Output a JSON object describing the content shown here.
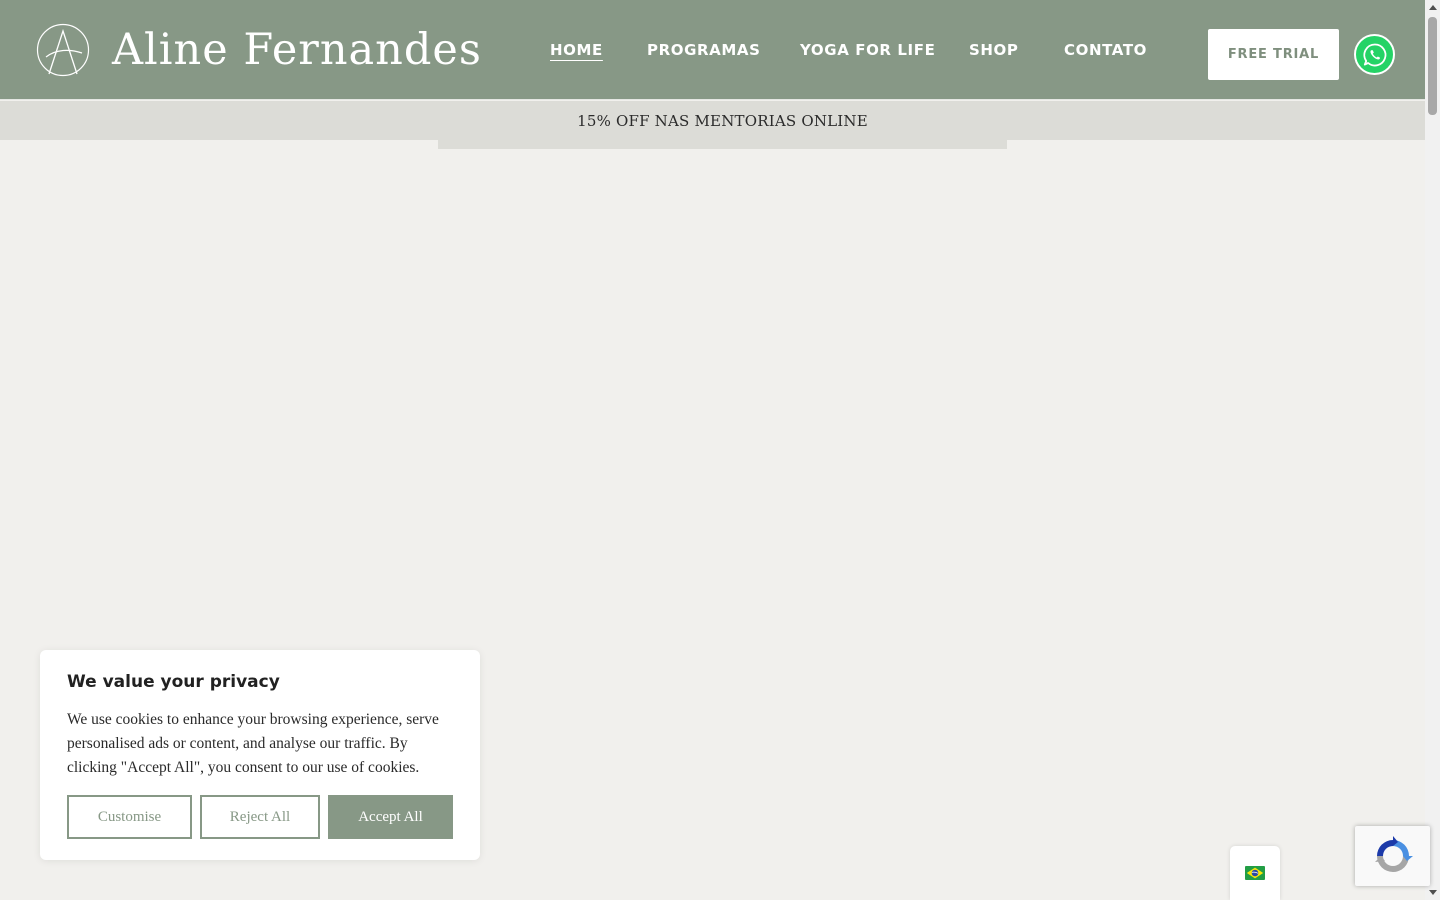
{
  "brand": {
    "name": "Aline Fernandes",
    "logo_letter": "A",
    "colors": {
      "primary": "#879886",
      "promo": "#dcdcd7",
      "background": "#f1f0ed",
      "whatsapp": "#25d366"
    }
  },
  "nav": {
    "items": [
      {
        "label": "HOME",
        "active": true
      },
      {
        "label": "PROGRAMAS",
        "active": false
      },
      {
        "label": "YOGA FOR LIFE",
        "active": false
      },
      {
        "label": "SHOP",
        "active": false
      },
      {
        "label": "CONTATO",
        "active": false
      }
    ],
    "cta_label": "FREE TRIAL",
    "whatsapp_icon": "whatsapp-icon"
  },
  "promo": {
    "text": "15% OFF NAS MENTORIAS ONLINE"
  },
  "cookie_banner": {
    "title": "We value your privacy",
    "body": "We use cookies to enhance your browsing experience, serve personalised ads or content, and analyse our traffic. By clicking \"Accept All\", you consent to our use of cookies.",
    "customise_label": "Customise",
    "reject_label": "Reject All",
    "accept_label": "Accept All"
  },
  "language_switcher": {
    "icon": "brazil-flag-icon"
  },
  "recaptcha": {
    "icon": "recaptcha-icon"
  }
}
